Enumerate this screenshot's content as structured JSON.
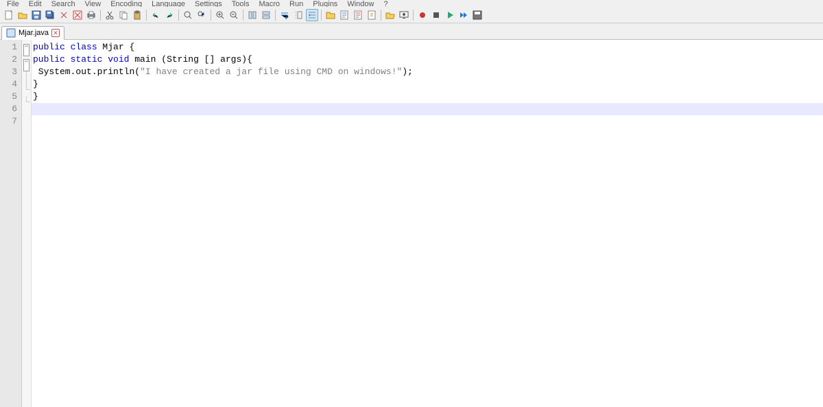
{
  "menus": [
    "File",
    "Edit",
    "Search",
    "View",
    "Encoding",
    "Language",
    "Settings",
    "Tools",
    "Macro",
    "Run",
    "Plugins",
    "Window",
    "?"
  ],
  "toolbar_icons": [
    "new-file-icon",
    "open-file-icon",
    "save-icon",
    "save-all-icon",
    "close-icon",
    "close-all-icon",
    "print-icon",
    "|",
    "cut-icon",
    "copy-icon",
    "paste-icon",
    "|",
    "undo-icon",
    "redo-icon",
    "|",
    "find-icon",
    "replace-icon",
    "|",
    "zoom-in-icon",
    "zoom-out-icon",
    "|",
    "sync-v-icon",
    "sync-h-icon",
    "|",
    "word-wrap-icon",
    "show-all-chars-icon",
    "indent-guide-icon",
    "|",
    "folder-icon",
    "doc-icon",
    "doc2-icon",
    "function-list-icon",
    "|",
    "folder-open-icon",
    "monitor-icon",
    "|",
    "record-icon",
    "stop-icon",
    "play-icon",
    "fast-forward-icon",
    "save-macro-icon"
  ],
  "tab": {
    "label": "Mjar.java"
  },
  "code": {
    "lines": [
      {
        "n": 1,
        "tokens": [
          {
            "t": "public",
            "c": "kw"
          },
          {
            "t": " class ",
            "c": "kw"
          },
          {
            "t": "Mjar ",
            "c": "ident"
          },
          {
            "t": "{",
            "c": "punct"
          }
        ]
      },
      {
        "n": 2,
        "tokens": [
          {
            "t": "public static void",
            "c": "kw"
          },
          {
            "t": " main ",
            "c": "ident"
          },
          {
            "t": "(",
            "c": "punct"
          },
          {
            "t": "String ",
            "c": "ident"
          },
          {
            "t": "[] ",
            "c": "punct"
          },
          {
            "t": "args",
            "c": "ident"
          },
          {
            "t": "){",
            "c": "punct"
          }
        ]
      },
      {
        "n": 3,
        "tokens": [
          {
            "t": " System",
            "c": "ident"
          },
          {
            "t": ".",
            "c": "punct"
          },
          {
            "t": "out",
            "c": "ident"
          },
          {
            "t": ".",
            "c": "punct"
          },
          {
            "t": "println",
            "c": "ident"
          },
          {
            "t": "(",
            "c": "punct"
          },
          {
            "t": "\"I have created a jar file using CMD on windows!\"",
            "c": "str"
          },
          {
            "t": ");",
            "c": "punct"
          }
        ]
      },
      {
        "n": 4,
        "tokens": [
          {
            "t": "}",
            "c": "punct"
          }
        ]
      },
      {
        "n": 5,
        "tokens": [
          {
            "t": "}",
            "c": "punct"
          }
        ]
      },
      {
        "n": 6,
        "tokens": []
      },
      {
        "n": 7,
        "tokens": []
      }
    ],
    "current_line": 6,
    "fold": [
      "box",
      "box",
      "line",
      "end",
      "end",
      "",
      ""
    ]
  }
}
